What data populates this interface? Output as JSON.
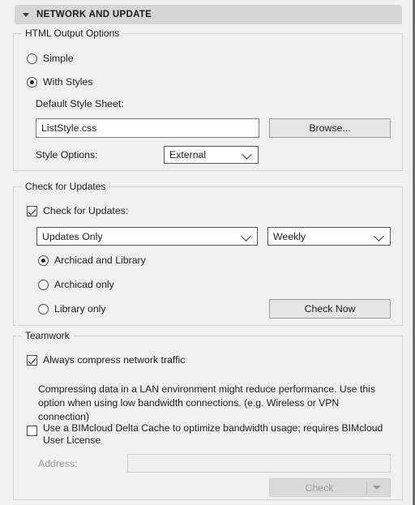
{
  "section": {
    "title": "NETWORK AND UPDATE",
    "expander_icon": "triangle-down-icon",
    "expanded": true
  },
  "html_output_options": {
    "legend": "HTML Output Options",
    "radios": [
      {
        "label": "Simple",
        "selected": false
      },
      {
        "label": "With Styles",
        "selected": true
      }
    ],
    "default_style_sheet_label": "Default Style Sheet:",
    "style_sheet_value": "ListStyle.css",
    "style_sheet_placeholder": "",
    "browse_label": "Browse...",
    "style_options_label": "Style Options:",
    "style_options_value": "External",
    "style_options_choices": [
      "External"
    ]
  },
  "check_for_updates": {
    "legend": "Check for Updates",
    "enable_label": "Check for Updates:",
    "enable_checked": true,
    "scope_value": "Updates Only",
    "scope_choices": [
      "Updates Only"
    ],
    "frequency_value": "Weekly",
    "frequency_choices": [
      "Weekly"
    ],
    "radios": [
      {
        "label": "Archicad and Library",
        "selected": true
      },
      {
        "label": "Archicad only",
        "selected": false
      },
      {
        "label": "Library only",
        "selected": false
      }
    ],
    "check_now_label": "Check Now"
  },
  "teamwork": {
    "legend": "Teamwork",
    "compress_label": "Always compress network traffic",
    "compress_checked": true,
    "help_text": "Compressing data in a LAN environment might reduce performance. Use this option when using low bandwidth connections. (e.g. Wireless or VPN connection)",
    "delta_cache_label": "Use a BIMcloud Delta Cache to optimize bandwidth usage; requires BIMcloud User License",
    "delta_cache_checked": false,
    "address_label": "Address:",
    "address_value": "",
    "address_placeholder": "",
    "check_label": "Check",
    "check_disabled": true,
    "check_dropdown_icon": "triangle-down-icon"
  },
  "colors": {
    "background": "#f0f0f0",
    "header_bar": "#d6d6d6",
    "group_border": "#d2d2d2",
    "text": "#1d1d1d",
    "disabled_text": "#9a9a9a",
    "input_border": "#7a7a7a",
    "button_face": "#e4e4e4"
  }
}
